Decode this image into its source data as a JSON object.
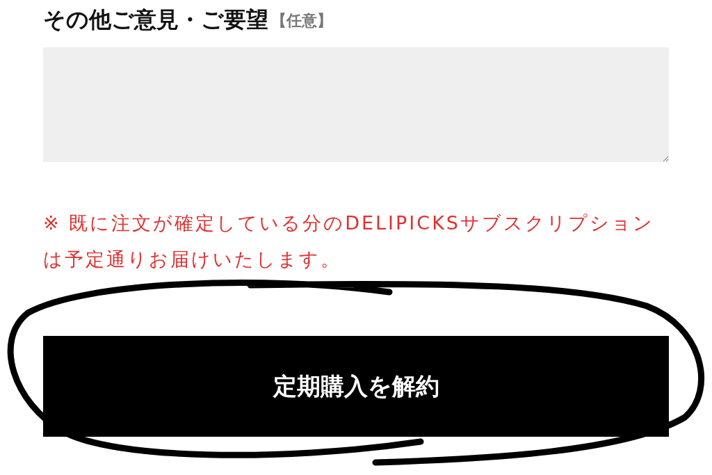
{
  "field": {
    "label": "その他ご意見・ご要望",
    "optional_tag": "【任意】"
  },
  "notice": "※ 既に注文が確定している分のDELIPICKSサブスクリプションは予定通りお届けいたします。",
  "button": {
    "label": "定期購入を解約"
  }
}
